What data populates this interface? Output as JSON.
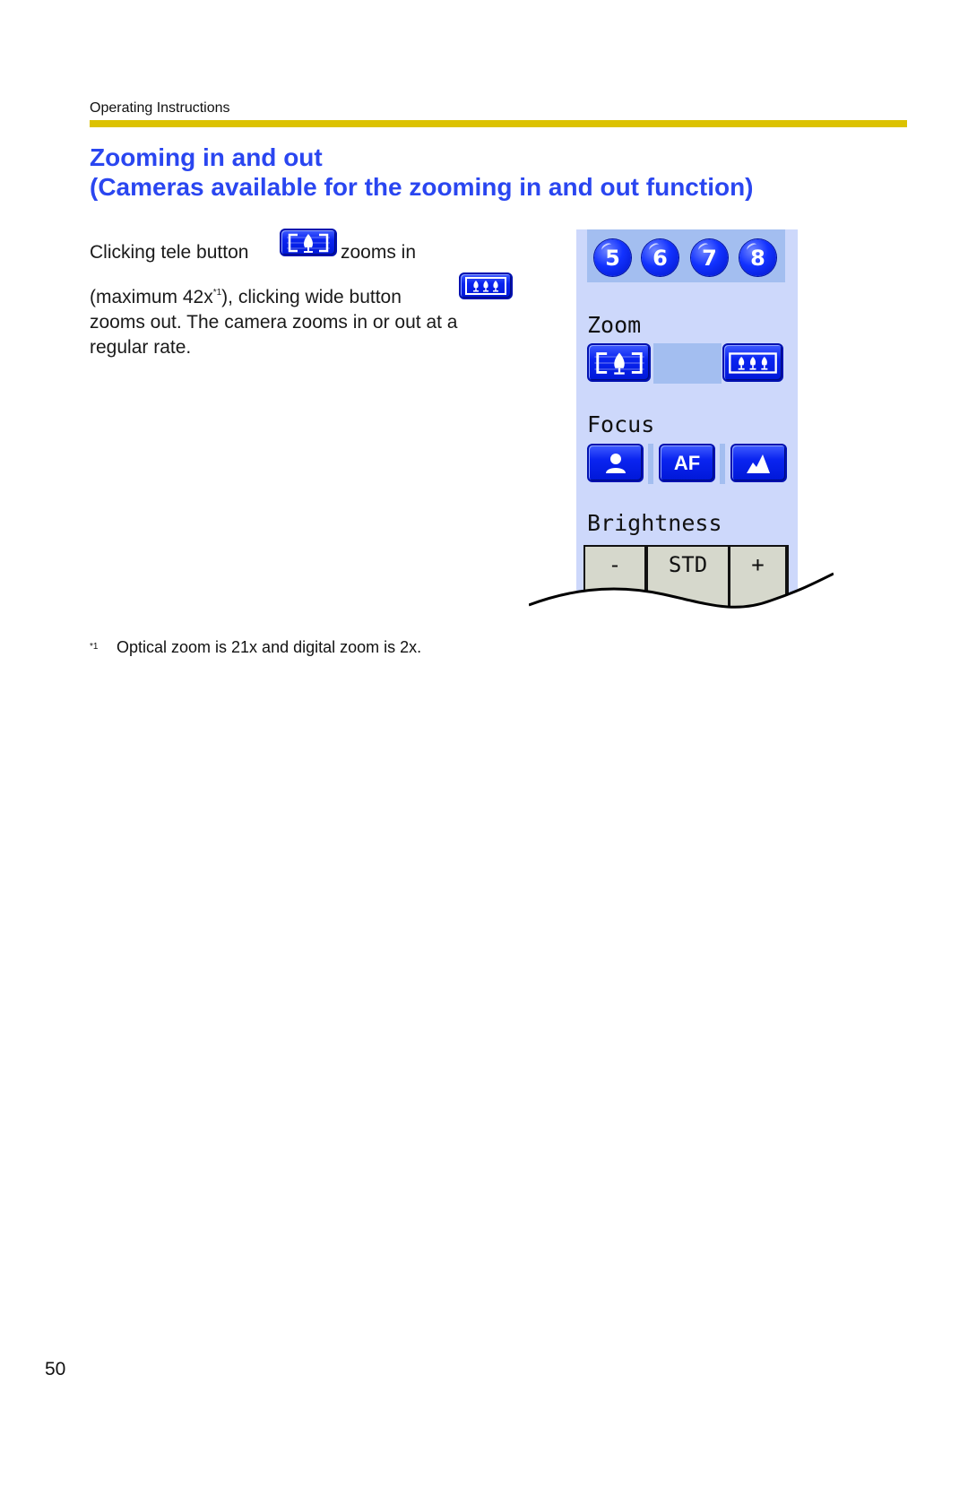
{
  "header": {
    "running_head": "Operating Instructions",
    "rule_color": "#dcc200"
  },
  "section": {
    "title_line1": "Zooming in and out",
    "title_line2": "(Cameras available for the zooming in and out function)",
    "title_color": "#2a46f0"
  },
  "body": {
    "line1_before": "Clicking tele button",
    "line1_after": "zooms in",
    "line2_before": "(maximum 42x",
    "line2_footnote_ref": "*1",
    "line2_after": "), clicking wide button",
    "line3": "zooms out. The camera zooms in or out at a",
    "line4": "regular rate.",
    "inline_icons": [
      "zoom-tele-icon",
      "zoom-wide-icon"
    ]
  },
  "panel": {
    "presets": [
      "5",
      "6",
      "7",
      "8"
    ],
    "zoom_label": "Zoom",
    "zoom_buttons": [
      "tele",
      "wide"
    ],
    "focus_label": "Focus",
    "focus_buttons": {
      "near": "near-focus-icon",
      "auto": "AF",
      "far": "far-focus-icon"
    },
    "brightness_label": "Brightness",
    "brightness_buttons": [
      "-",
      "STD",
      "+"
    ]
  },
  "footnote": {
    "mark": "*1",
    "text": "Optical zoom is 21x and digital zoom is 2x."
  },
  "page_number": "50"
}
